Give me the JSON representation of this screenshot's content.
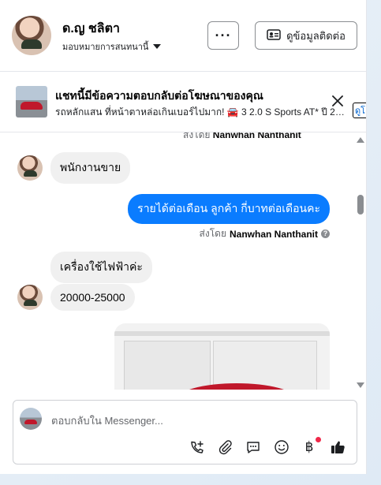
{
  "header": {
    "contact_name": "ด.ญ ชลิตา",
    "assign_label": "มอบหมายการสนทนานี้",
    "more_label": "···",
    "contact_info_label": "ดูข้อมูลติดต่อ"
  },
  "ad_banner": {
    "title": "แชทนี้มีข้อความตอบกลับต่อโฆษณาของคุณ",
    "description": "รถหลักแสน ที่หน้าตาหล่อเกินเบอร์ไปมาก! 🚘 3 2.0 S Sports AT* ปี 201...",
    "view_link_label": "ดูโ"
  },
  "messages": {
    "partial_sent_by_prefix": "ส่งโดย",
    "partial_sent_by_name": "Nanwhan Nanthanit",
    "items": [
      {
        "direction": "in",
        "text": "พนักงานขาย"
      },
      {
        "direction": "out",
        "text": "รายได้ต่อเดือน  ลูกค้า  กี่บาทต่อเดือนคะ"
      },
      {
        "direction": "in",
        "text": "เครื่องใช้ไฟฟ้าค่ะ"
      },
      {
        "direction": "in",
        "text": "20000-25000"
      }
    ],
    "sent_by_prefix": "ส่งโดย",
    "sent_by_name": "Nanwhan Nanthanit"
  },
  "composer": {
    "placeholder": "ตอบกลับใน Messenger...",
    "baht_symbol": "฿",
    "icons": [
      "call-add-icon",
      "attachment-icon",
      "saved-reply-icon",
      "emoji-icon",
      "payment-icon",
      "like-icon"
    ]
  },
  "colors": {
    "accent_blue": "#0a7cff",
    "incoming_bubble": "#f0f0f0",
    "notification_red": "#f02849"
  }
}
